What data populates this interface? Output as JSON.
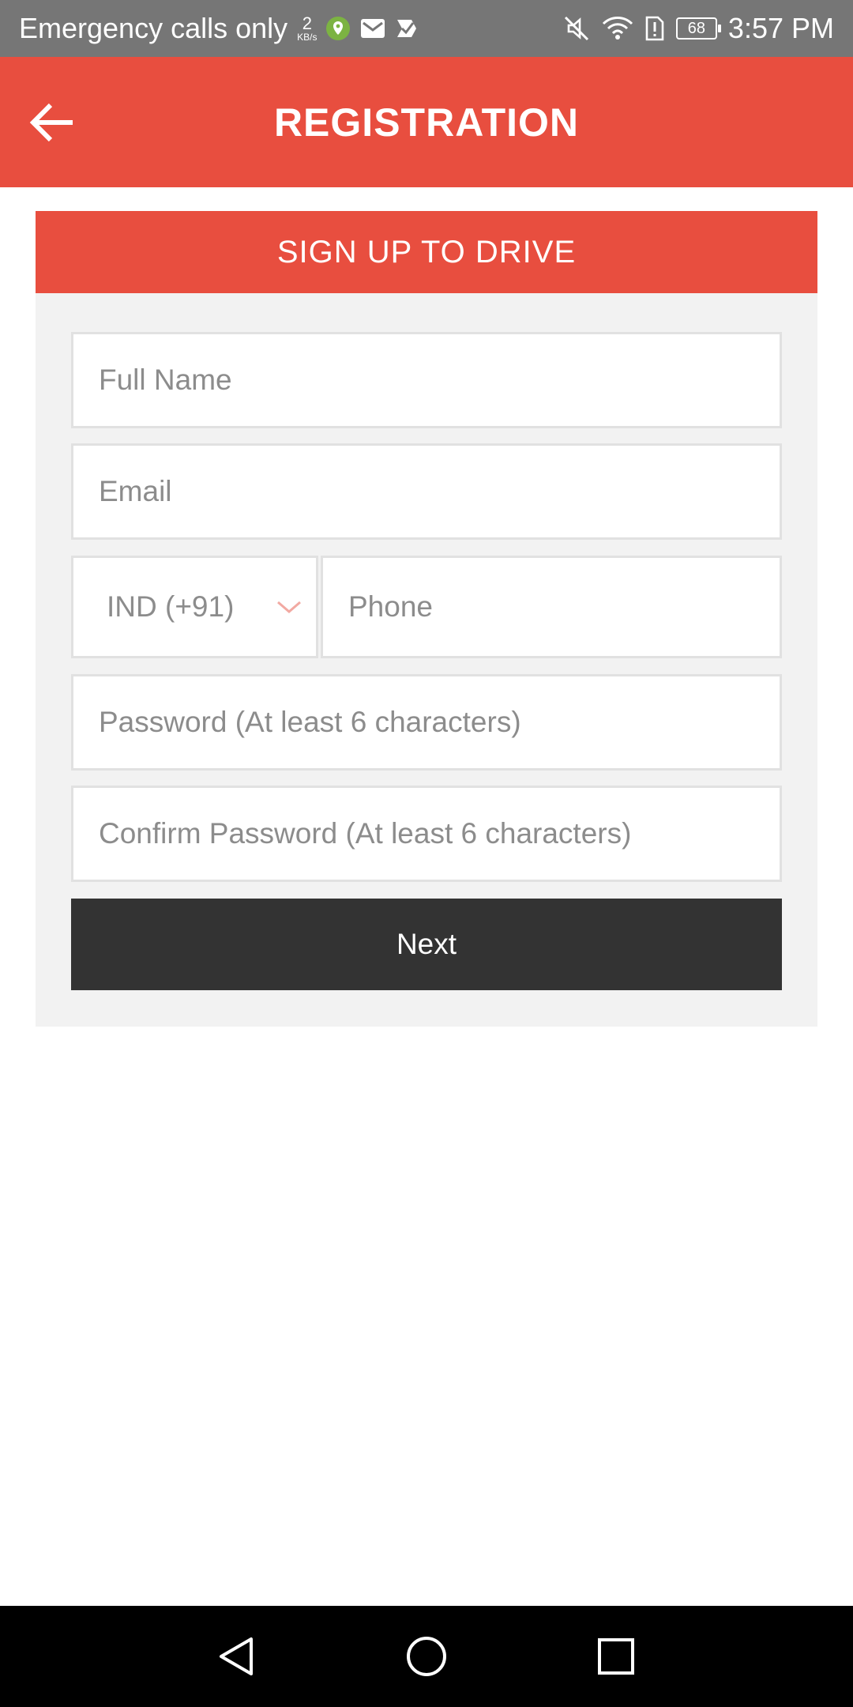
{
  "status_bar": {
    "carrier_text": "Emergency calls only",
    "data_rate_value": "2",
    "data_rate_unit": "KB/s",
    "battery_level": "68",
    "time": "3:57 PM",
    "icons": [
      "location-icon",
      "mail-icon",
      "tasks-icon",
      "mute-icon",
      "wifi-icon",
      "sim-alert-icon",
      "battery-icon"
    ]
  },
  "app_bar": {
    "title": "REGISTRATION",
    "back_icon": "arrow-left-icon",
    "background_color": "#e84e3f"
  },
  "form": {
    "header": "SIGN UP TO DRIVE",
    "full_name_placeholder": "Full Name",
    "email_placeholder": "Email",
    "country_code_value": "IND (+91)",
    "phone_placeholder": "Phone",
    "password_placeholder": "Password (At least 6 characters)",
    "confirm_password_placeholder": "Confirm Password (At least 6 characters)",
    "next_label": "Next"
  },
  "nav_bar": {
    "items": [
      "back-icon",
      "home-icon",
      "recents-icon"
    ]
  }
}
